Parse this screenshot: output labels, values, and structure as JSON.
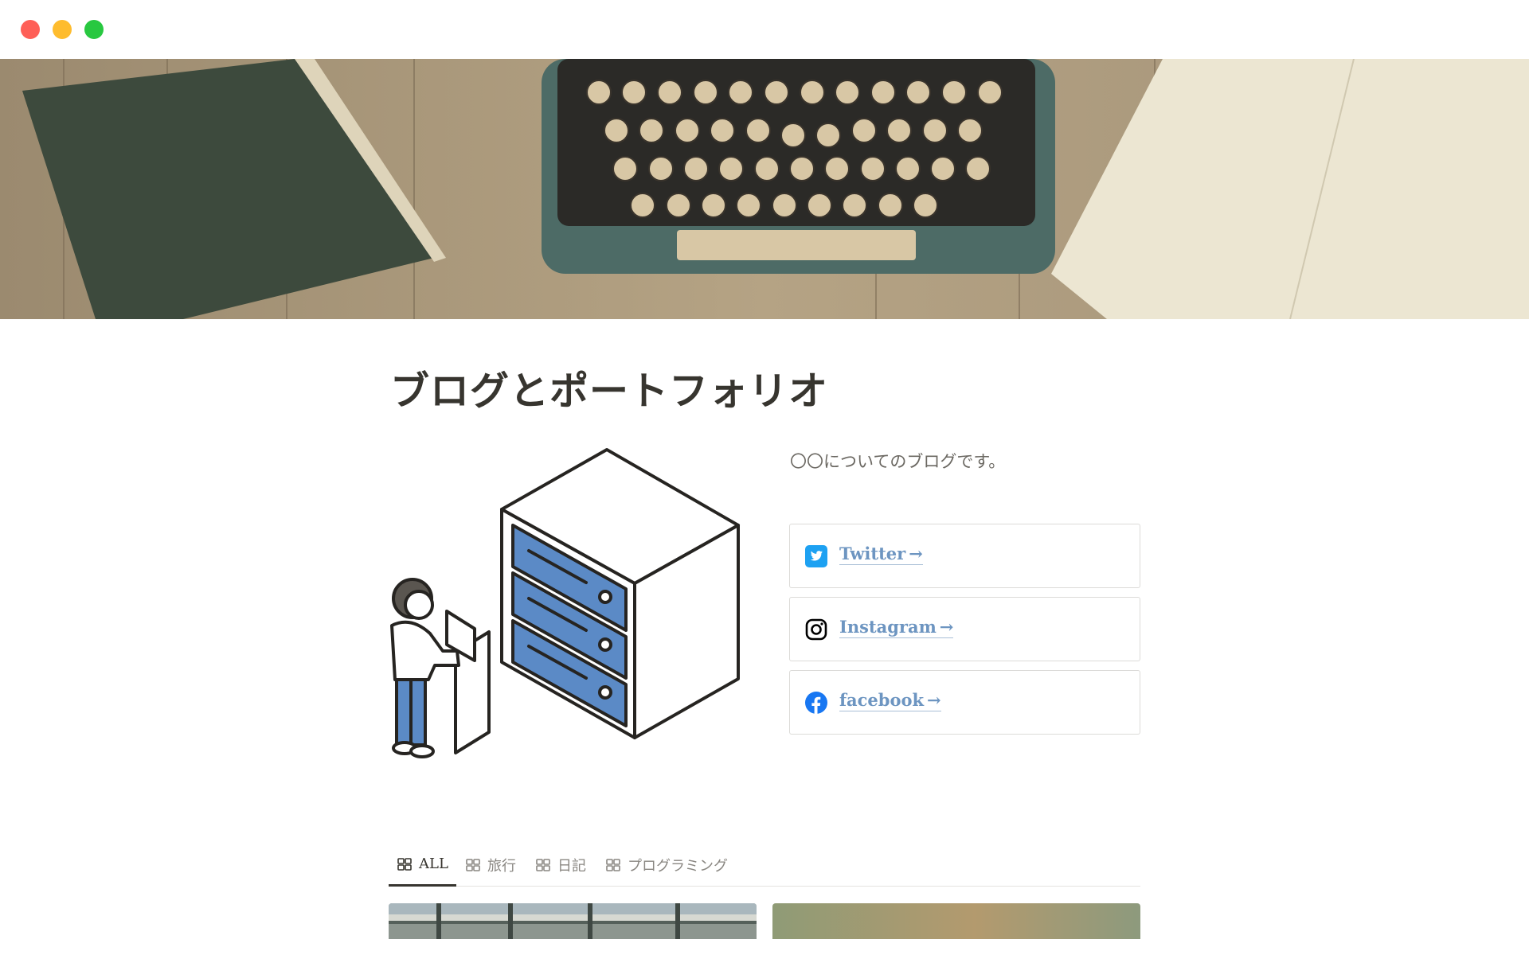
{
  "window": {
    "controls": [
      "close",
      "minimize",
      "zoom"
    ]
  },
  "cover": {
    "image": "typewriter-book-notebook-cover"
  },
  "page": {
    "title": "ブログとポートフォリオ",
    "description": "〇〇についてのブログです。",
    "illustration": "person-at-server-cabinet"
  },
  "links": [
    {
      "label": "Twitter",
      "arrow": "→",
      "icon": "twitter-icon",
      "color": "#1da1f2"
    },
    {
      "label": "Instagram",
      "arrow": "→",
      "icon": "instagram-icon",
      "color": "#000000"
    },
    {
      "label": "facebook",
      "arrow": "→",
      "icon": "facebook-icon",
      "color": "#1877f2"
    }
  ],
  "tabs": [
    {
      "label": "ALL",
      "icon": "gallery-view-icon",
      "active": true
    },
    {
      "label": "旅行",
      "icon": "gallery-view-icon",
      "active": false
    },
    {
      "label": "日記",
      "icon": "gallery-view-icon",
      "active": false
    },
    {
      "label": "プログラミング",
      "icon": "gallery-view-icon",
      "active": false
    }
  ],
  "gallery": {
    "cards": [
      {
        "image": "bridge-railing-photo"
      },
      {
        "image": "sunset-gradient-photo"
      }
    ]
  },
  "colors": {
    "link_text": "#6d95c1",
    "illustration_blue": "#5b8ac6",
    "title_text": "#37352f"
  }
}
